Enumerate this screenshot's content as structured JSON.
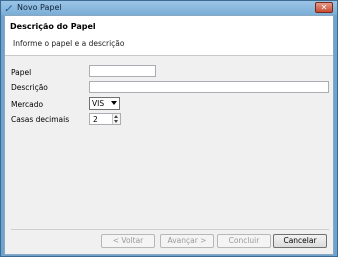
{
  "window": {
    "title": "Novo Papel",
    "close_label": "✕"
  },
  "banner": {
    "title": "Descrição do Papel",
    "subtitle": "Informe o papel e a descrição"
  },
  "form": {
    "papel": {
      "label": "Papel",
      "value": ""
    },
    "descricao": {
      "label": "Descrição",
      "value": ""
    },
    "mercado": {
      "label": "Mercado",
      "value": "VIS"
    },
    "casas_decimais": {
      "label": "Casas decimais",
      "value": "2"
    }
  },
  "buttons": {
    "voltar": "< Voltar",
    "avancar": "Avançar >",
    "concluir": "Concluir",
    "cancelar": "Cancelar"
  },
  "icons": {
    "app": "feather-quill-icon",
    "combo_arrow": "chevron-down-icon",
    "spin_up": "arrow-up-icon",
    "spin_down": "arrow-down-icon"
  }
}
